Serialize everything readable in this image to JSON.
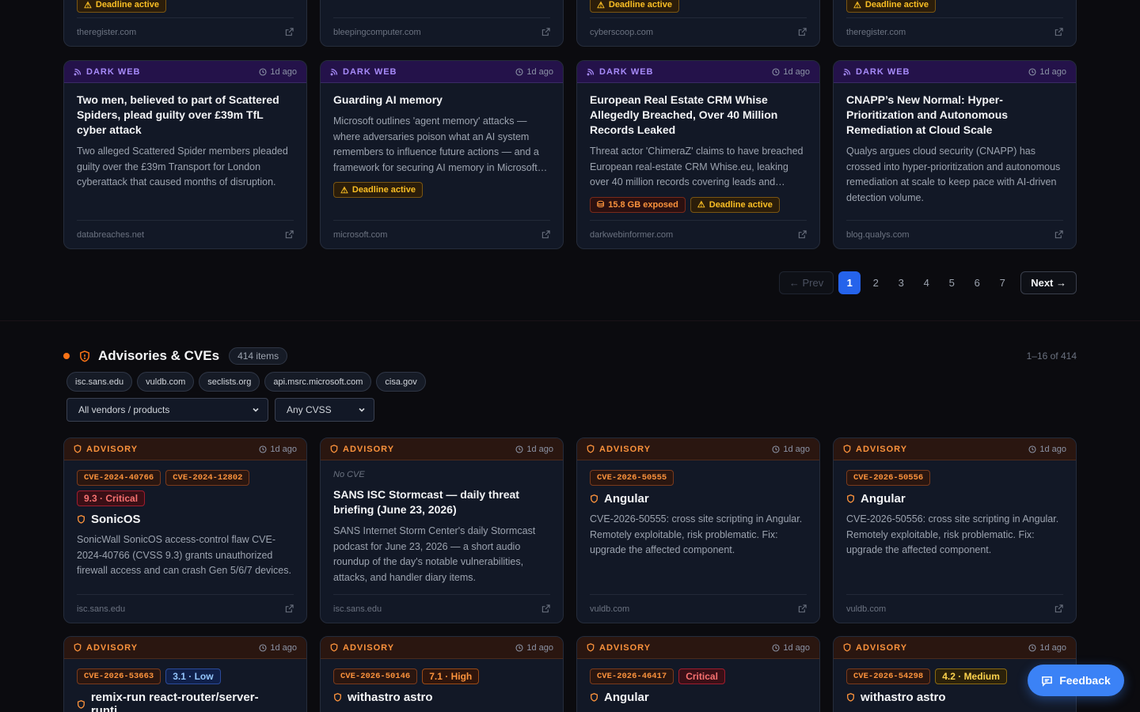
{
  "row0": [
    {
      "badge": "Deadline active",
      "source": "theregister.com"
    },
    {
      "badge": "",
      "source": "bleepingcomputer.com"
    },
    {
      "badge": "Deadline active",
      "source": "cyberscoop.com"
    },
    {
      "badge": "Deadline active",
      "source": "theregister.com"
    }
  ],
  "dark_web_cards": [
    {
      "category": "DARK WEB",
      "time": "1d ago",
      "title": "Two men, believed to part of Scattered Spiders, plead guilty over £39m TfL cyber attack",
      "desc": "Two alleged Scattered Spider members pleaded guilty over the £39m Transport for London cyberattack that caused months of disruption.",
      "source": "databreaches.net"
    },
    {
      "category": "DARK WEB",
      "time": "1d ago",
      "title": "Guarding AI memory",
      "desc": "Microsoft outlines 'agent memory' attacks — where adversaries poison what an AI system remembers to influence future actions — and a framework for securing AI memory in Microsoft 365.",
      "badge_deadline": "Deadline active",
      "source": "microsoft.com"
    },
    {
      "category": "DARK WEB",
      "time": "1d ago",
      "title": "European Real Estate CRM Whise Allegedly Breached, Over 40 Million Records Leaked",
      "desc": "Threat actor 'ChimeraZ' claims to have breached European real-estate CRM Whise.eu, leaking over 40 million records covering leads and contacts.",
      "badge_exposed": "15.8 GB exposed",
      "badge_deadline": "Deadline active",
      "source": "darkwebinformer.com"
    },
    {
      "category": "DARK WEB",
      "time": "1d ago",
      "title": "CNAPP’s New Normal: Hyper-Prioritization and Autonomous Remediation at Cloud Scale",
      "desc": "Qualys argues cloud security (CNAPP) has crossed into hyper-prioritization and autonomous remediation at scale to keep pace with AI-driven detection volume.",
      "source": "blog.qualys.com"
    }
  ],
  "pagination": {
    "prev": "← Prev",
    "next": "Next →",
    "pages": [
      "1",
      "2",
      "3",
      "4",
      "5",
      "6",
      "7"
    ],
    "current": "1"
  },
  "section": {
    "title": "Advisories & CVEs",
    "count": "414 items",
    "range": "1–16 of 414",
    "sources": [
      "isc.sans.edu",
      "vuldb.com",
      "seclists.org",
      "api.msrc.microsoft.com",
      "cisa.gov"
    ],
    "vendor_filter": "All vendors / products",
    "cvss_filter": "Any CVSS"
  },
  "advisories": [
    {
      "category": "ADVISORY",
      "time": "1d ago",
      "cves": [
        "CVE-2024-40766",
        "CVE-2024-12802"
      ],
      "severity": "9.3 · Critical",
      "vendor": "SonicOS",
      "desc": "SonicWall SonicOS access-control flaw CVE-2024-40766 (CVSS 9.3) grants unauthorized firewall access and can crash Gen 5/6/7 devices.",
      "source": "isc.sans.edu"
    },
    {
      "category": "ADVISORY",
      "time": "1d ago",
      "no_cve": "No CVE",
      "title": "SANS ISC Stormcast — daily threat briefing (June 23, 2026)",
      "desc": "SANS Internet Storm Center's daily Stormcast podcast for June 23, 2026 — a short audio roundup of the day's notable vulnerabilities, attacks, and handler diary items.",
      "source": "isc.sans.edu"
    },
    {
      "category": "ADVISORY",
      "time": "1d ago",
      "cves": [
        "CVE-2026-50555"
      ],
      "vendor": "Angular",
      "desc": "CVE-2026-50555: cross site scripting in Angular. Remotely exploitable, risk problematic. Fix: upgrade the affected component.",
      "source": "vuldb.com"
    },
    {
      "category": "ADVISORY",
      "time": "1d ago",
      "cves": [
        "CVE-2026-50556"
      ],
      "vendor": "Angular",
      "desc": "CVE-2026-50556: cross site scripting in Angular. Remotely exploitable, risk problematic. Fix: upgrade the affected component.",
      "source": "vuldb.com"
    }
  ],
  "advisories_row2": [
    {
      "category": "ADVISORY",
      "time": "1d ago",
      "cve": "CVE-2026-53663",
      "severity": "3.1 · Low",
      "vendor": "remix-run react-router/server-runti…"
    },
    {
      "category": "ADVISORY",
      "time": "1d ago",
      "cve": "CVE-2026-50146",
      "severity": "7.1 · High",
      "vendor": "withastro astro"
    },
    {
      "category": "ADVISORY",
      "time": "1d ago",
      "cve": "CVE-2026-46417",
      "severity": "Critical",
      "vendor": "Angular"
    },
    {
      "category": "ADVISORY",
      "time": "1d ago",
      "cve": "CVE-2026-54298",
      "severity": "4.2 · Medium",
      "vendor": "withastro astro"
    }
  ],
  "feedback_label": "Feedback"
}
